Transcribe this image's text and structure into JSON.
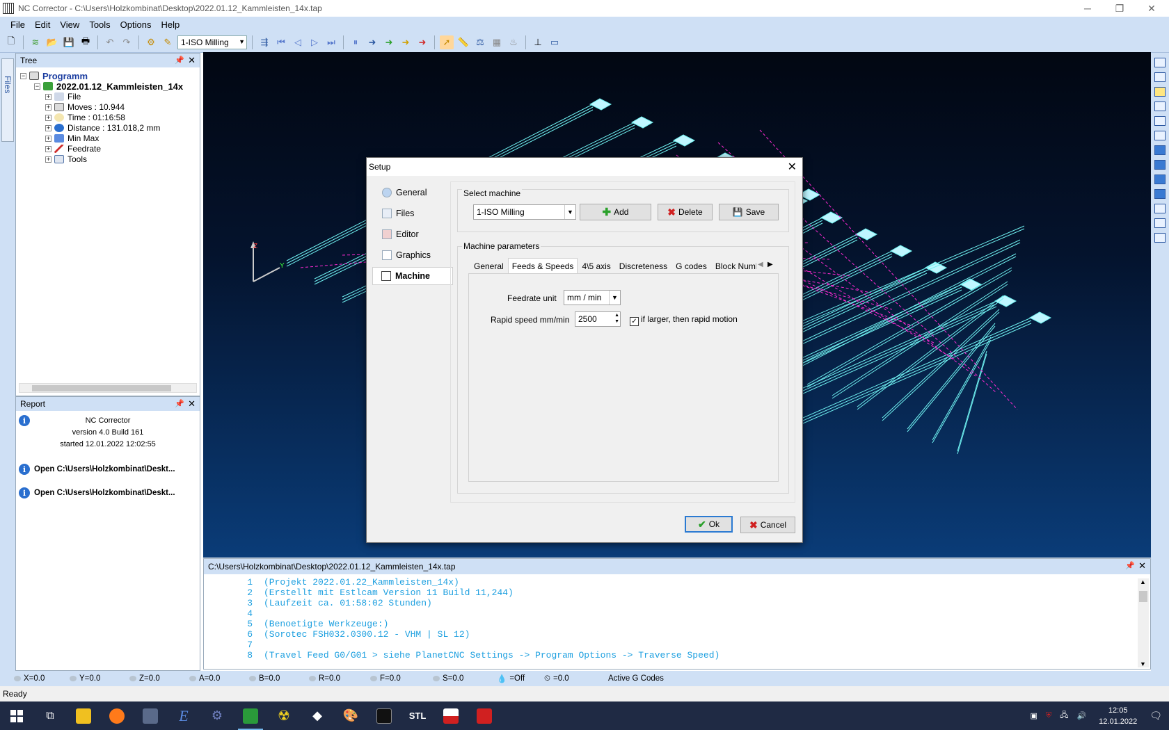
{
  "window": {
    "title": "NC Corrector - C:\\Users\\Holzkombinat\\Desktop\\2022.01.12_Kammleisten_14x.tap"
  },
  "menu": [
    "File",
    "Edit",
    "View",
    "Tools",
    "Options",
    "Help"
  ],
  "toolbar": {
    "machine_select": "1-ISO Milling"
  },
  "files_tab": "Files",
  "tree": {
    "title": "Tree",
    "root": "Programm",
    "file": "2022.01.12_Kammleisten_14x",
    "items": [
      "File",
      "Moves : 10.944",
      "Time : 01:16:58",
      "Distance : 131.018,2 mm",
      "Min Max",
      "Feedrate",
      "Tools"
    ]
  },
  "report": {
    "title": "Report",
    "app": "NC Corrector",
    "version": "version 4.0 Build 161",
    "started": "started 12.01.2022 12:02:55",
    "lines": [
      "Open C:\\Users\\Holzkombinat\\Deskt...",
      "Open C:\\Users\\Holzkombinat\\Deskt..."
    ]
  },
  "viewport": {
    "axis_z": "Z",
    "axis_y": "Y",
    "colors": {
      "wire": "#6ff0f0",
      "path": "#ff2ad4",
      "pad": "#bff6ff"
    }
  },
  "editor": {
    "path": "C:\\Users\\Holzkombinat\\Desktop\\2022.01.12_Kammleisten_14x.tap",
    "lines": [
      {
        "n": "1",
        "text": "(Projekt 2022.01.22_Kammleisten_14x)"
      },
      {
        "n": "2",
        "text": "(Erstellt mit Estlcam Version 11 Build 11,244)"
      },
      {
        "n": "3",
        "text": "(Laufzeit ca. 01:58:02 Stunden)"
      },
      {
        "n": "4",
        "text": ""
      },
      {
        "n": "5",
        "text": "(Benoetigte Werkzeuge:)"
      },
      {
        "n": "6",
        "text": "(Sorotec FSH032.0300.12 - VHM | SL 12)"
      },
      {
        "n": "7",
        "text": ""
      },
      {
        "n": "8",
        "text": "(Travel Feed G0/G01 > siehe PlanetCNC Settings -> Program Options -> Traverse Speed)"
      }
    ]
  },
  "coords": [
    "X=0.0",
    "Y=0.0",
    "Z=0.0",
    "A=0.0",
    "B=0.0",
    "R=0.0",
    "F=0.0",
    "S=0.0",
    "=Off",
    "=0.0",
    "Active G Codes"
  ],
  "status": "Ready",
  "clock": {
    "time": "12:05",
    "date": "12.01.2022"
  },
  "taskbar_apps": [
    "STL"
  ],
  "dialog": {
    "title": "Setup",
    "nav": [
      "General",
      "Files",
      "Editor",
      "Graphics",
      "Machine"
    ],
    "select_machine_label": "Select machine",
    "machine_value": "1-ISO Milling",
    "add": "Add",
    "delete": "Delete",
    "save": "Save",
    "params_label": "Machine parameters",
    "tabs": [
      "General",
      "Feeds & Speeds",
      "4\\5 axis",
      "Discreteness",
      "G codes",
      "Block Numb"
    ],
    "feedrate_unit_label": "Feedrate unit",
    "feedrate_unit_value": "mm / min",
    "rapid_label": "Rapid speed mm/min",
    "rapid_value": "2500",
    "rapid_check_label": "if larger, then rapid motion",
    "ok": "Ok",
    "cancel": "Cancel"
  }
}
